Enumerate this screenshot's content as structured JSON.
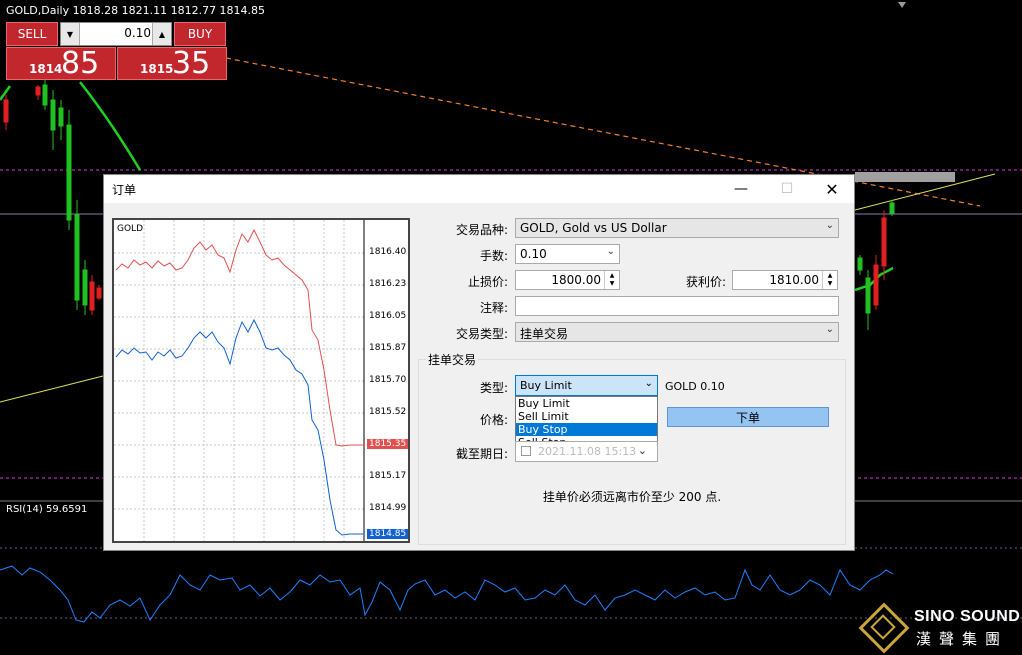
{
  "chart": {
    "symbol_line": "GOLD,Daily  1818.28 1821.11 1812.77 1814.85",
    "rsi_label": "RSI(14) 59.6591"
  },
  "trade_panel": {
    "sell_label": "SELL",
    "buy_label": "BUY",
    "lots": "0.10",
    "bid_small": "1814",
    "bid_big": "85",
    "ask_small": "1815",
    "ask_big": "35",
    "color": "#c1272d"
  },
  "dialog": {
    "title": "订单",
    "fields": {
      "symbol_label": "交易品种:",
      "symbol_value": "GOLD, Gold vs US Dollar",
      "volume_label": "手数:",
      "volume_value": "0.10",
      "sl_label": "止损价:",
      "sl_value": "1800.00",
      "tp_label": "获利价:",
      "tp_value": "1810.00",
      "comment_label": "注释:",
      "order_type_label": "交易类型:",
      "order_type_value": "挂单交易"
    },
    "pending": {
      "group_title": "挂单交易",
      "type_label": "类型:",
      "type_value": "Buy Limit",
      "type_options": [
        "Buy Limit",
        "Sell Limit",
        "Buy Stop",
        "Sell Stop"
      ],
      "type_highlighted": "Buy Stop",
      "summary": "GOLD 0.10",
      "price_label": "价格:",
      "place_button": "下单",
      "expiry_label": "截至期日:",
      "expiry_value": "2021.11.08 15:13",
      "note": "挂单价必须远离市价至少 200 点."
    },
    "mini_chart": {
      "symbol": "GOLD",
      "price_ticks": [
        "1816.40",
        "1816.23",
        "1816.05",
        "1815.87",
        "1815.70",
        "1815.52",
        "1815.35",
        "1815.17",
        "1814.99",
        "1814.85"
      ],
      "ask_tag": "1815.35",
      "bid_tag": "1814.85",
      "ask_color": "#e05050",
      "bid_color": "#1060d0"
    }
  },
  "logo": {
    "name": "SINO SOUND",
    "cn": "漢聲集團"
  }
}
